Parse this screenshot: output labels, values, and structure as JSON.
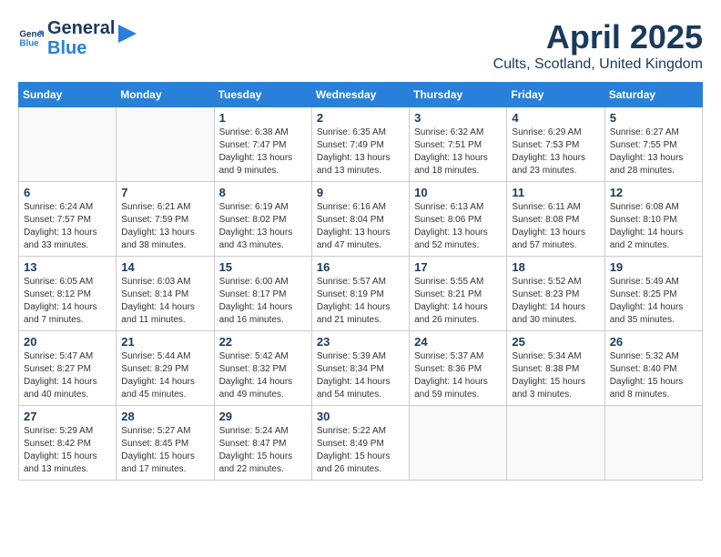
{
  "header": {
    "logo_general": "General",
    "logo_blue": "Blue",
    "month": "April 2025",
    "location": "Cults, Scotland, United Kingdom"
  },
  "weekdays": [
    "Sunday",
    "Monday",
    "Tuesday",
    "Wednesday",
    "Thursday",
    "Friday",
    "Saturday"
  ],
  "weeks": [
    [
      {
        "day": "",
        "info": ""
      },
      {
        "day": "",
        "info": ""
      },
      {
        "day": "1",
        "info": "Sunrise: 6:38 AM\nSunset: 7:47 PM\nDaylight: 13 hours and 9 minutes."
      },
      {
        "day": "2",
        "info": "Sunrise: 6:35 AM\nSunset: 7:49 PM\nDaylight: 13 hours and 13 minutes."
      },
      {
        "day": "3",
        "info": "Sunrise: 6:32 AM\nSunset: 7:51 PM\nDaylight: 13 hours and 18 minutes."
      },
      {
        "day": "4",
        "info": "Sunrise: 6:29 AM\nSunset: 7:53 PM\nDaylight: 13 hours and 23 minutes."
      },
      {
        "day": "5",
        "info": "Sunrise: 6:27 AM\nSunset: 7:55 PM\nDaylight: 13 hours and 28 minutes."
      }
    ],
    [
      {
        "day": "6",
        "info": "Sunrise: 6:24 AM\nSunset: 7:57 PM\nDaylight: 13 hours and 33 minutes."
      },
      {
        "day": "7",
        "info": "Sunrise: 6:21 AM\nSunset: 7:59 PM\nDaylight: 13 hours and 38 minutes."
      },
      {
        "day": "8",
        "info": "Sunrise: 6:19 AM\nSunset: 8:02 PM\nDaylight: 13 hours and 43 minutes."
      },
      {
        "day": "9",
        "info": "Sunrise: 6:16 AM\nSunset: 8:04 PM\nDaylight: 13 hours and 47 minutes."
      },
      {
        "day": "10",
        "info": "Sunrise: 6:13 AM\nSunset: 8:06 PM\nDaylight: 13 hours and 52 minutes."
      },
      {
        "day": "11",
        "info": "Sunrise: 6:11 AM\nSunset: 8:08 PM\nDaylight: 13 hours and 57 minutes."
      },
      {
        "day": "12",
        "info": "Sunrise: 6:08 AM\nSunset: 8:10 PM\nDaylight: 14 hours and 2 minutes."
      }
    ],
    [
      {
        "day": "13",
        "info": "Sunrise: 6:05 AM\nSunset: 8:12 PM\nDaylight: 14 hours and 7 minutes."
      },
      {
        "day": "14",
        "info": "Sunrise: 6:03 AM\nSunset: 8:14 PM\nDaylight: 14 hours and 11 minutes."
      },
      {
        "day": "15",
        "info": "Sunrise: 6:00 AM\nSunset: 8:17 PM\nDaylight: 14 hours and 16 minutes."
      },
      {
        "day": "16",
        "info": "Sunrise: 5:57 AM\nSunset: 8:19 PM\nDaylight: 14 hours and 21 minutes."
      },
      {
        "day": "17",
        "info": "Sunrise: 5:55 AM\nSunset: 8:21 PM\nDaylight: 14 hours and 26 minutes."
      },
      {
        "day": "18",
        "info": "Sunrise: 5:52 AM\nSunset: 8:23 PM\nDaylight: 14 hours and 30 minutes."
      },
      {
        "day": "19",
        "info": "Sunrise: 5:49 AM\nSunset: 8:25 PM\nDaylight: 14 hours and 35 minutes."
      }
    ],
    [
      {
        "day": "20",
        "info": "Sunrise: 5:47 AM\nSunset: 8:27 PM\nDaylight: 14 hours and 40 minutes."
      },
      {
        "day": "21",
        "info": "Sunrise: 5:44 AM\nSunset: 8:29 PM\nDaylight: 14 hours and 45 minutes."
      },
      {
        "day": "22",
        "info": "Sunrise: 5:42 AM\nSunset: 8:32 PM\nDaylight: 14 hours and 49 minutes."
      },
      {
        "day": "23",
        "info": "Sunrise: 5:39 AM\nSunset: 8:34 PM\nDaylight: 14 hours and 54 minutes."
      },
      {
        "day": "24",
        "info": "Sunrise: 5:37 AM\nSunset: 8:36 PM\nDaylight: 14 hours and 59 minutes."
      },
      {
        "day": "25",
        "info": "Sunrise: 5:34 AM\nSunset: 8:38 PM\nDaylight: 15 hours and 3 minutes."
      },
      {
        "day": "26",
        "info": "Sunrise: 5:32 AM\nSunset: 8:40 PM\nDaylight: 15 hours and 8 minutes."
      }
    ],
    [
      {
        "day": "27",
        "info": "Sunrise: 5:29 AM\nSunset: 8:42 PM\nDaylight: 15 hours and 13 minutes."
      },
      {
        "day": "28",
        "info": "Sunrise: 5:27 AM\nSunset: 8:45 PM\nDaylight: 15 hours and 17 minutes."
      },
      {
        "day": "29",
        "info": "Sunrise: 5:24 AM\nSunset: 8:47 PM\nDaylight: 15 hours and 22 minutes."
      },
      {
        "day": "30",
        "info": "Sunrise: 5:22 AM\nSunset: 8:49 PM\nDaylight: 15 hours and 26 minutes."
      },
      {
        "day": "",
        "info": ""
      },
      {
        "day": "",
        "info": ""
      },
      {
        "day": "",
        "info": ""
      }
    ]
  ]
}
